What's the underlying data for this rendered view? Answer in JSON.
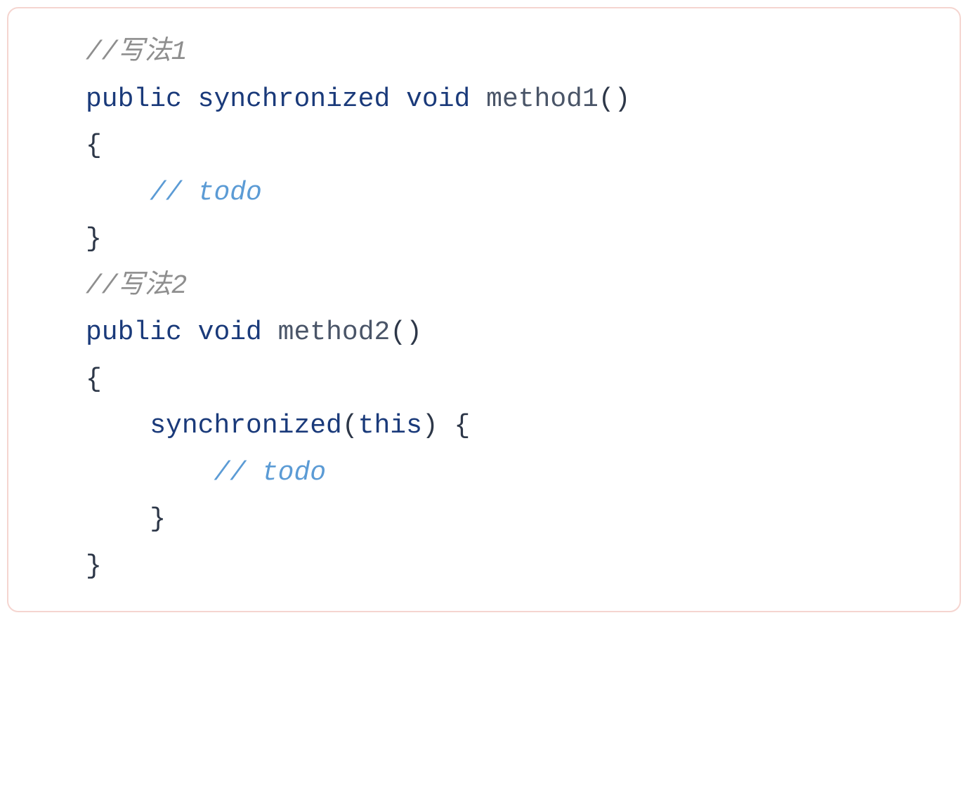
{
  "code": {
    "lines": [
      {
        "type": "comment1",
        "text": "//写法1"
      },
      {
        "type": "method1_sig",
        "tokens": [
          {
            "class": "keyword",
            "text": "public"
          },
          {
            "class": "plain",
            "text": " "
          },
          {
            "class": "keyword",
            "text": "synchronized"
          },
          {
            "class": "plain",
            "text": " "
          },
          {
            "class": "keyword",
            "text": "void"
          },
          {
            "class": "plain",
            "text": " "
          },
          {
            "class": "method-name",
            "text": "method1"
          },
          {
            "class": "paren",
            "text": "()"
          }
        ]
      },
      {
        "type": "brace",
        "text": "{"
      },
      {
        "type": "todo1",
        "indent": "    ",
        "comment_prefix": "// ",
        "comment_body": "todo"
      },
      {
        "type": "brace",
        "text": "}"
      },
      {
        "type": "comment2",
        "text": "//写法2"
      },
      {
        "type": "method2_sig",
        "tokens": [
          {
            "class": "keyword",
            "text": "public"
          },
          {
            "class": "plain",
            "text": " "
          },
          {
            "class": "keyword",
            "text": "void"
          },
          {
            "class": "plain",
            "text": " "
          },
          {
            "class": "method-name",
            "text": "method2"
          },
          {
            "class": "paren",
            "text": "()"
          }
        ]
      },
      {
        "type": "brace",
        "text": "{"
      },
      {
        "type": "sync_block",
        "indent": "    ",
        "tokens": [
          {
            "class": "keyword",
            "text": "synchronized"
          },
          {
            "class": "paren",
            "text": "("
          },
          {
            "class": "this-kw",
            "text": "this"
          },
          {
            "class": "paren",
            "text": ")"
          },
          {
            "class": "plain",
            "text": " "
          },
          {
            "class": "brace",
            "text": "{"
          }
        ]
      },
      {
        "type": "todo2",
        "indent": "        ",
        "comment_prefix": "// ",
        "comment_body": "todo"
      },
      {
        "type": "close_inner",
        "indent": "    ",
        "text": "}"
      },
      {
        "type": "brace",
        "text": "}"
      }
    ]
  }
}
